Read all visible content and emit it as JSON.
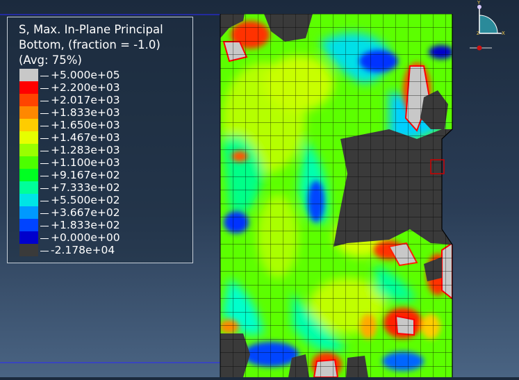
{
  "legend": {
    "title_line1": "S, Max. In-Plane Principal",
    "title_line2": "Bottom, (fraction = -1.0)",
    "title_line3": "(Avg: 75%)",
    "entries": [
      {
        "label": "+5.000e+05",
        "color": "#c8c8c8"
      },
      {
        "label": "+2.200e+03",
        "color": "#ff0000"
      },
      {
        "label": "+2.017e+03",
        "color": "#ff4400"
      },
      {
        "label": "+1.833e+03",
        "color": "#ff8800"
      },
      {
        "label": "+1.650e+03",
        "color": "#ffcc00"
      },
      {
        "label": "+1.467e+03",
        "color": "#e6ff00"
      },
      {
        "label": "+1.283e+03",
        "color": "#99ff00"
      },
      {
        "label": "+1.100e+03",
        "color": "#4cff00"
      },
      {
        "label": "+9.167e+02",
        "color": "#00ff22"
      },
      {
        "label": "+7.333e+02",
        "color": "#00ff99"
      },
      {
        "label": "+5.500e+02",
        "color": "#00e5e5"
      },
      {
        "label": "+3.667e+02",
        "color": "#0099ff"
      },
      {
        "label": "+1.833e+02",
        "color": "#0044ff"
      },
      {
        "label": "+0.000e+00",
        "color": "#0000cc"
      },
      {
        "label": "-2.178e+04",
        "color": "#3a3a3a"
      }
    ]
  },
  "triad": {
    "y_label": "Y",
    "x_label": "X",
    "z_label": "Z"
  }
}
